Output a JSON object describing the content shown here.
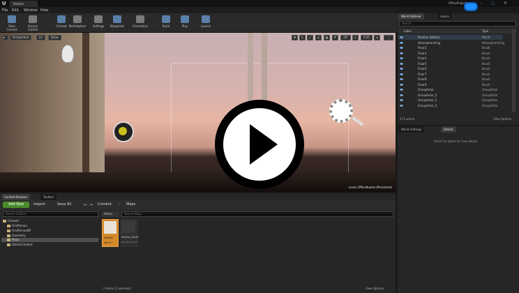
{
  "titlebar": {
    "app_letter": "U",
    "tab": "Pavilion",
    "project": "OfficeProject"
  },
  "menu": [
    "File",
    "Edit",
    "Window",
    "Help"
  ],
  "toolbar": [
    {
      "label": "Save Current",
      "color": "#5a7fa8"
    },
    {
      "label": "Source Control",
      "color": "#7a7a7a"
    },
    {
      "label": "Content",
      "color": "#5a7fa8"
    },
    {
      "label": "Marketplace",
      "color": "#7a7a7a"
    },
    {
      "label": "Settings",
      "color": "#7a7a7a"
    },
    {
      "label": "Blueprints",
      "color": "#5a7fa8"
    },
    {
      "label": "Cinematics",
      "color": "#7a7a7a"
    },
    {
      "label": "Build",
      "color": "#5a7fa8"
    },
    {
      "label": "Play",
      "color": "#5a7fa8"
    },
    {
      "label": "Launch",
      "color": "#5a7fa8"
    }
  ],
  "viewport": {
    "perspective": "Perspective",
    "lit": "Lit",
    "show": "Show",
    "snap1": "10°",
    "snap2": "0.25",
    "level": "Level:",
    "level_name": "OfficeRooms (Persistent)"
  },
  "content_browser": {
    "tabs": [
      "Content Browser",
      "Toolbox"
    ],
    "add_new": "Add New",
    "import": "Import",
    "save_all": "Save All",
    "path": [
      "Content",
      "Maps"
    ],
    "search_folders_placeholder": "Search Folders",
    "search_maps_placeholder": "Search Maps",
    "filters": "Filters",
    "tree": [
      "Content",
      "FirstPerson",
      "FirstPersonBP",
      "Geometry",
      "Maps",
      "StarterContent"
    ],
    "assets": [
      {
        "name": "Pavilion",
        "sub": "World"
      },
      {
        "name": "Pavilion_BuiltData",
        "sub": "Map Build Data Registry"
      }
    ],
    "status": "2 items (1 selected)",
    "view_options": "View Options"
  },
  "outliner": {
    "tabs": [
      "World Outliner",
      "Layers"
    ],
    "search_placeholder": "Search...",
    "columns": [
      "Label",
      "Type"
    ],
    "rows": [
      {
        "label": "Pavilion (Editor)",
        "type": "World"
      },
      {
        "label": "AtmosphericFog",
        "type": "AtmosphericFog"
      },
      {
        "label": "Floor2",
        "type": "Brush"
      },
      {
        "label": "Floor3",
        "type": "Brush"
      },
      {
        "label": "Floor4",
        "type": "Brush"
      },
      {
        "label": "Floor5",
        "type": "Brush"
      },
      {
        "label": "Floor6",
        "type": "Brush"
      },
      {
        "label": "Floor7",
        "type": "Brush"
      },
      {
        "label": "Floor8",
        "type": "Brush"
      },
      {
        "label": "Floor9",
        "type": "Brush"
      },
      {
        "label": "GroupActor",
        "type": "GroupActor"
      },
      {
        "label": "GroupActor_2",
        "type": "GroupActor"
      },
      {
        "label": "GroupActor_3",
        "type": "GroupActor"
      },
      {
        "label": "GroupActor_5",
        "type": "GroupActor"
      }
    ],
    "count": "171 actors",
    "view_options": "View Options"
  },
  "details": {
    "tabs": [
      "World Settings",
      "Details"
    ],
    "empty": "Select an object to view details."
  },
  "colors": {
    "accent": "#1e8fff",
    "add_new": "#4a8a2a"
  }
}
